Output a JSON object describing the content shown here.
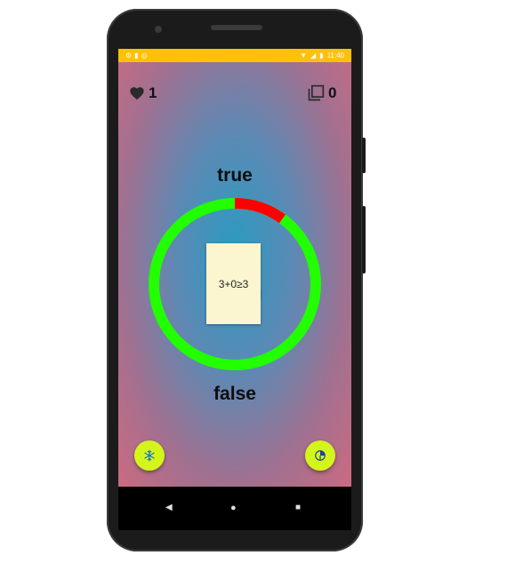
{
  "status_bar": {
    "time": "11:40"
  },
  "stats": {
    "lives": "1",
    "cards": "0"
  },
  "game": {
    "true_label": "true",
    "false_label": "false",
    "expression": "3+0≥3",
    "timer_fraction_elapsed": 0.1
  },
  "icons": {
    "lives": "heart-icon",
    "cards": "card-stack-icon",
    "left_button": "snowflake-icon",
    "right_button": "timer-icon"
  },
  "colors": {
    "status_bar": "#ffc107",
    "ring_remaining": "#22ff00",
    "ring_elapsed": "#ff0000",
    "fab": "#d4f51c",
    "card": "#fbf6cf"
  }
}
